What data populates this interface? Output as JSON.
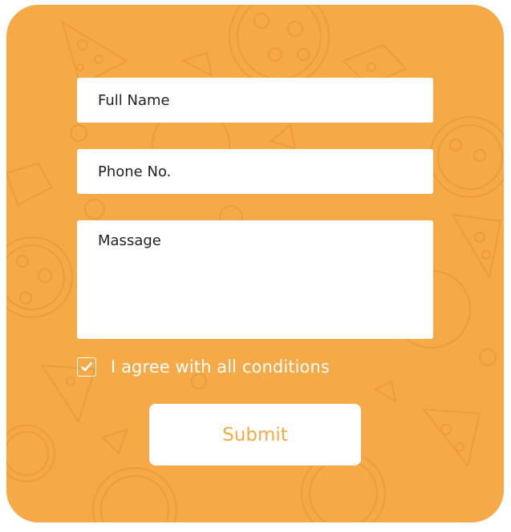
{
  "form": {
    "name_placeholder": "Full Name",
    "phone_placeholder": "Phone No.",
    "message_placeholder": "Massage",
    "agree_label": "I agree with all conditions",
    "agree_checked": true,
    "submit_label": "Submit"
  },
  "colors": {
    "card_background": "#f5a947",
    "field_background": "#ffffff",
    "submit_text": "#f5a947",
    "label_text": "#ffffff"
  },
  "icons": {
    "checkbox": "checkmark-icon",
    "background": "pizza-pattern"
  }
}
